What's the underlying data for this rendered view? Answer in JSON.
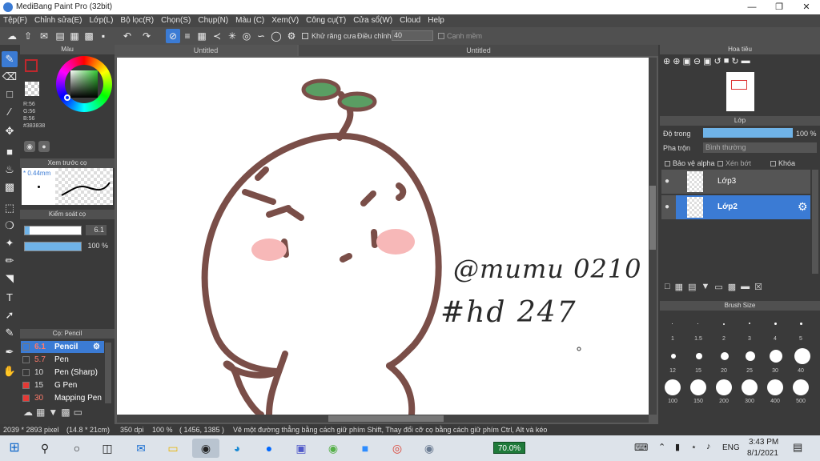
{
  "window": {
    "title": "MediBang Paint Pro (32bit)"
  },
  "menu": [
    "Tệp(F)",
    "Chỉnh sửa(E)",
    "Lớp(L)",
    "Bộ lọc(R)",
    "Chọn(S)",
    "Chụp(N)",
    "Màu (C)",
    "Xem(V)",
    "Công cụ(T)",
    "Cửa sổ(W)",
    "Cloud",
    "Help"
  ],
  "toolbar": {
    "antialias_label": "Khử răng cưa",
    "correction_label": "Điều chỉnh",
    "correction_value": "40",
    "edge_label": "Cạnh mềm"
  },
  "color_panel": {
    "title": "Màu",
    "r": "R:56",
    "g": "G:56",
    "b": "B:56",
    "hex": "#383838"
  },
  "preview_panel": {
    "title": "Xem trước cọ",
    "size": "* 0.44mm"
  },
  "brush_control": {
    "title": "Kiểm soát cọ",
    "size": "6.1",
    "opacity": "100 %"
  },
  "brush_list": {
    "title": "Cọ: Pencil",
    "items": [
      {
        "size": "6.1",
        "name": "Pencil",
        "color": "#383838"
      },
      {
        "size": "5.7",
        "name": "Pen",
        "color": "#383838"
      },
      {
        "size": "10",
        "name": "Pen (Sharp)",
        "color": "#383838"
      },
      {
        "size": "15",
        "name": "G Pen",
        "color": "#e53935"
      },
      {
        "size": "30",
        "name": "Mapping Pen",
        "color": "#e53935"
      }
    ]
  },
  "tabs": [
    "Untitled",
    "Untitled"
  ],
  "canvas": {
    "line1": "@mumu 0210",
    "line2": "#hd 247"
  },
  "navigator": {
    "title": "Hoa tiêu"
  },
  "layer_panel": {
    "title": "Lớp",
    "opacity_label": "Độ trong",
    "opacity_value": "100 %",
    "blend_label": "Pha trộn",
    "blend_value": "Bình thường",
    "protect_alpha": "Bảo vệ alpha",
    "clipping": "Xén bớt",
    "lock": "Khóa",
    "layers": [
      "Lớp3",
      "Lớp2"
    ]
  },
  "brush_size": {
    "title": "Brush Size",
    "labels": [
      "1",
      "1.5",
      "2",
      "3",
      "4",
      "5",
      "12",
      "15",
      "20",
      "25",
      "30",
      "40",
      "100",
      "150",
      "200",
      "300",
      "400",
      "500"
    ]
  },
  "status": {
    "dims": "2039 * 2893 pixel",
    "cm": "(14.8 * 21cm)",
    "dpi": "350 dpi",
    "zoom": "100 %",
    "coords": "( 1456, 1385 )",
    "hint": "Vẽ một đường thẳng bằng cách giữ phím Shift, Thay đổi cỡ cọ bằng cách giữ phím Ctrl, Alt và kéo"
  },
  "taskbar": {
    "battery": "70.0%",
    "lang": "ENG",
    "time": "3:43 PM",
    "date": "8/1/2021"
  }
}
